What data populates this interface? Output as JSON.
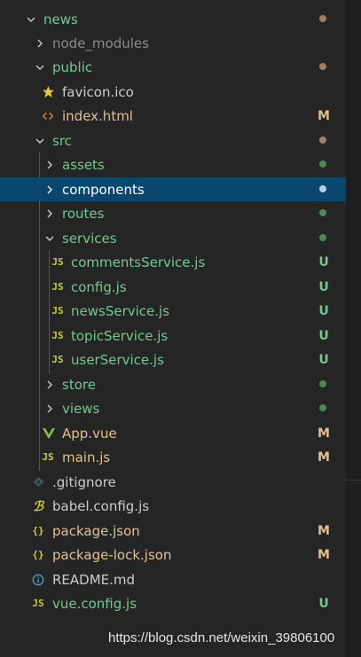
{
  "top_partial_text": "",
  "colors": {
    "folder_green": "#73c991",
    "modified_yellow": "#e2c08d",
    "untracked_green": "#73c991",
    "ignored_gray": "#8c8c8c",
    "folder_dot_brown": "#a08060",
    "folder_dot_green": "#4a8a4f",
    "selected_bg": "#094771"
  },
  "tree": {
    "news": {
      "label": "news",
      "expanded": true
    },
    "node_modules": {
      "label": "node_modules",
      "expanded": false
    },
    "public": {
      "label": "public",
      "expanded": true
    },
    "favicon": {
      "label": "favicon.ico",
      "icon": "star-icon"
    },
    "index_html": {
      "label": "index.html",
      "icon": "html-icon",
      "status": "M"
    },
    "src": {
      "label": "src",
      "expanded": true
    },
    "assets": {
      "label": "assets",
      "expanded": false
    },
    "components": {
      "label": "components",
      "expanded": false,
      "selected": true
    },
    "routes": {
      "label": "routes",
      "expanded": false
    },
    "services": {
      "label": "services",
      "expanded": true
    },
    "commentsService": {
      "label": "commentsService.js",
      "icon_text": "JS",
      "status": "U"
    },
    "config": {
      "label": "config.js",
      "icon_text": "JS",
      "status": "U"
    },
    "newsService": {
      "label": "newsService.js",
      "icon_text": "JS",
      "status": "U"
    },
    "topicService": {
      "label": "topicService.js",
      "icon_text": "JS",
      "status": "U"
    },
    "userService": {
      "label": "userService.js",
      "icon_text": "JS",
      "status": "U"
    },
    "store": {
      "label": "store",
      "expanded": false
    },
    "views": {
      "label": "views",
      "expanded": false
    },
    "app_vue": {
      "label": "App.vue",
      "icon": "vue-icon",
      "status": "M"
    },
    "main_js": {
      "label": "main.js",
      "icon_text": "JS",
      "status": "M"
    },
    "gitignore": {
      "label": ".gitignore",
      "icon": "git-icon"
    },
    "babel": {
      "label": "babel.config.js",
      "icon": "babel-icon"
    },
    "package_json": {
      "label": "package.json",
      "icon_text": "{}",
      "status": "M"
    },
    "package_lock": {
      "label": "package-lock.json",
      "icon_text": "{}",
      "status": "M"
    },
    "readme": {
      "label": "README.md",
      "icon": "info-icon"
    },
    "vue_config": {
      "label": "vue.config.js",
      "icon_text": "JS",
      "status": "U"
    }
  },
  "watermark": "https://blog.csdn.net/weixin_39806100"
}
